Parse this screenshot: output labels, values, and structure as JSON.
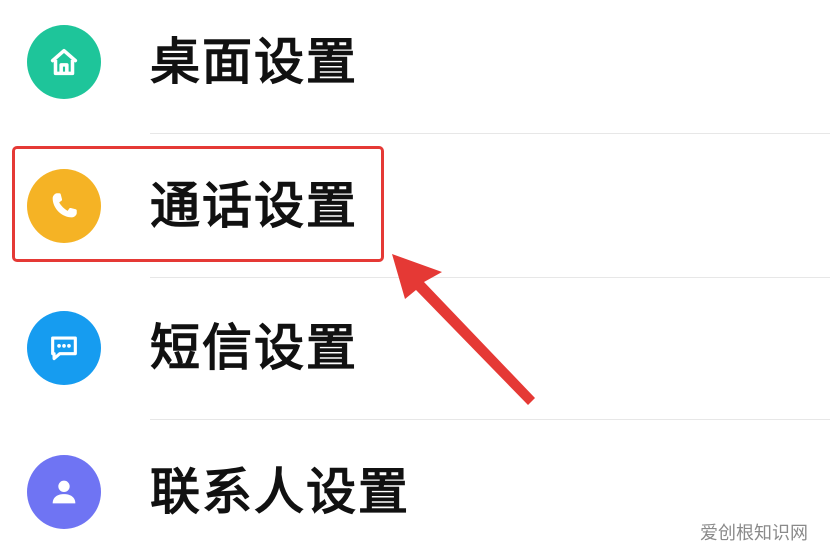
{
  "settings": {
    "items": [
      {
        "label": "桌面设置",
        "icon": "home-icon",
        "color": "#1ec59a"
      },
      {
        "label": "通话设置",
        "icon": "phone-icon",
        "color": "#f5b325"
      },
      {
        "label": "短信设置",
        "icon": "message-icon",
        "color": "#169cf0"
      },
      {
        "label": "联系人设置",
        "icon": "person-icon",
        "color": "#6f74f3"
      }
    ]
  },
  "highlight": {
    "color": "#e53935",
    "target": "通话设置"
  },
  "watermark": {
    "text": "爱创根知识网"
  }
}
